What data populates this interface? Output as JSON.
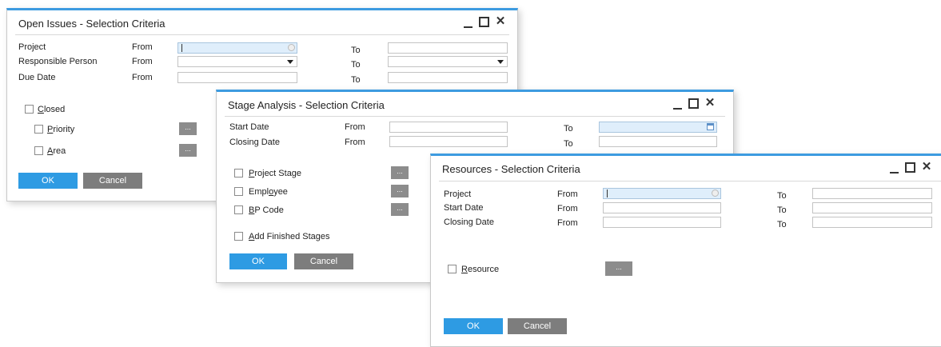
{
  "dialog1": {
    "title": "Open Issues - Selection Criteria",
    "rows": [
      {
        "label": "Project",
        "from": "From",
        "to": "To"
      },
      {
        "label": "Responsible Person",
        "from": "From",
        "to": "To"
      },
      {
        "label": "Due Date",
        "from": "From",
        "to": "To"
      }
    ],
    "closed": {
      "first": "C",
      "rest": "losed"
    },
    "priority": {
      "first": "P",
      "rest": "riority"
    },
    "area": {
      "first": "A",
      "rest": "rea"
    },
    "ellipsis": "...",
    "ok": "OK",
    "cancel": "Cancel"
  },
  "dialog2": {
    "title": "Stage Analysis - Selection Criteria",
    "rows": [
      {
        "label": "Start Date",
        "from": "From",
        "to": "To"
      },
      {
        "label": "Closing Date",
        "from": "From",
        "to": "To"
      }
    ],
    "project_stage": {
      "first": "P",
      "rest": "roject Stage"
    },
    "employee": {
      "pre": "Empl",
      "mid": "o",
      "rest": "yee"
    },
    "bp_code": {
      "first": "B",
      "rest": "P Code"
    },
    "add_finished": {
      "first": "A",
      "rest": "dd Finished Stages"
    },
    "ellipsis": "...",
    "ok": "OK",
    "cancel": "Cancel"
  },
  "dialog3": {
    "title": "Resources - Selection Criteria",
    "rows": [
      {
        "label": "Project",
        "from": "From",
        "to": "To"
      },
      {
        "label": "Start Date",
        "from": "From",
        "to": "To"
      },
      {
        "label": "Closing Date",
        "from": "From",
        "to": "To"
      }
    ],
    "resource": {
      "first": "R",
      "rest": "esource"
    },
    "ellipsis": "...",
    "ok": "OK",
    "cancel": "Cancel"
  },
  "window_controls": {
    "close_glyph": "✕"
  },
  "colors": {
    "accent": "#3d9be0",
    "ok_button": "#2e9be3",
    "cancel_button": "#7d7d7d",
    "active_field": "#dfeefb"
  }
}
